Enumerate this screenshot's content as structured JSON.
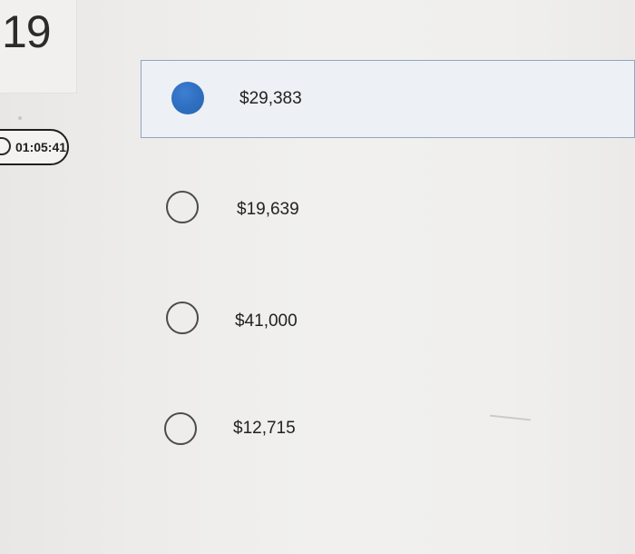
{
  "question": {
    "number": "19"
  },
  "timer": {
    "value": "01:05:41",
    "icon": "timer-icon"
  },
  "options": [
    {
      "label": "$29,383",
      "selected": true
    },
    {
      "label": "$19,639",
      "selected": false
    },
    {
      "label": "$41,000",
      "selected": false
    },
    {
      "label": "$12,715",
      "selected": false
    }
  ],
  "colors": {
    "accent": "#2f6fc2",
    "selected_border": "#8ea6c2",
    "selected_bg": "#edf0f4"
  }
}
